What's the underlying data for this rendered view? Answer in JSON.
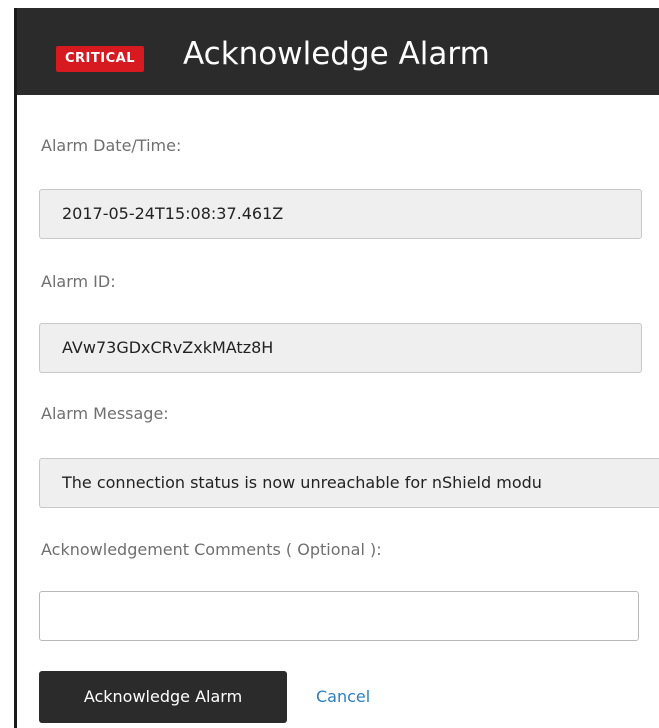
{
  "header": {
    "badge": "CRITICAL",
    "title": "Acknowledge Alarm"
  },
  "fields": {
    "alarm_datetime_label": "Alarm Date/Time:",
    "alarm_datetime_value": "2017-05-24T15:08:37.461Z",
    "alarm_id_label": "Alarm ID:",
    "alarm_id_value": "AVw73GDxCRvZxkMAtz8H",
    "alarm_message_label": "Alarm Message:",
    "alarm_message_value": "The connection status is now unreachable for nShield modu",
    "comments_label": "Acknowledgement Comments ( Optional ):",
    "comments_value": ""
  },
  "actions": {
    "acknowledge_label": "Acknowledge Alarm",
    "cancel_label": "Cancel"
  },
  "colors": {
    "header_bg": "#2b2b2b",
    "critical_badge": "#d71920",
    "link": "#2a7fc1"
  }
}
